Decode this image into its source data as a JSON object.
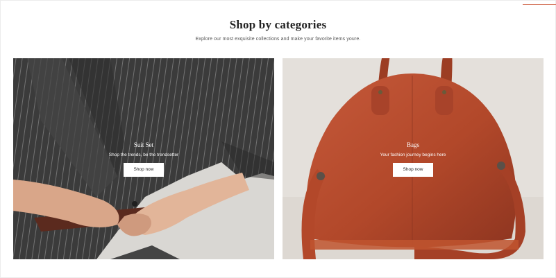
{
  "section": {
    "title": "Shop by categories",
    "subtitle": "Explore our most exquisite collections and make your favorite items youre."
  },
  "categories": [
    {
      "title": "Suit Set",
      "description": "Shop the trends, be the trendsetter",
      "button_label": "Shop now"
    },
    {
      "title": "Bags",
      "description": "Your fashion journey begins here",
      "button_label": "Shop now"
    }
  ],
  "colors": {
    "accent_line": "#d9826b",
    "suit_fabric": "#3a3a3a",
    "bag_leather": "#b2482a",
    "button_bg": "#ffffff"
  }
}
